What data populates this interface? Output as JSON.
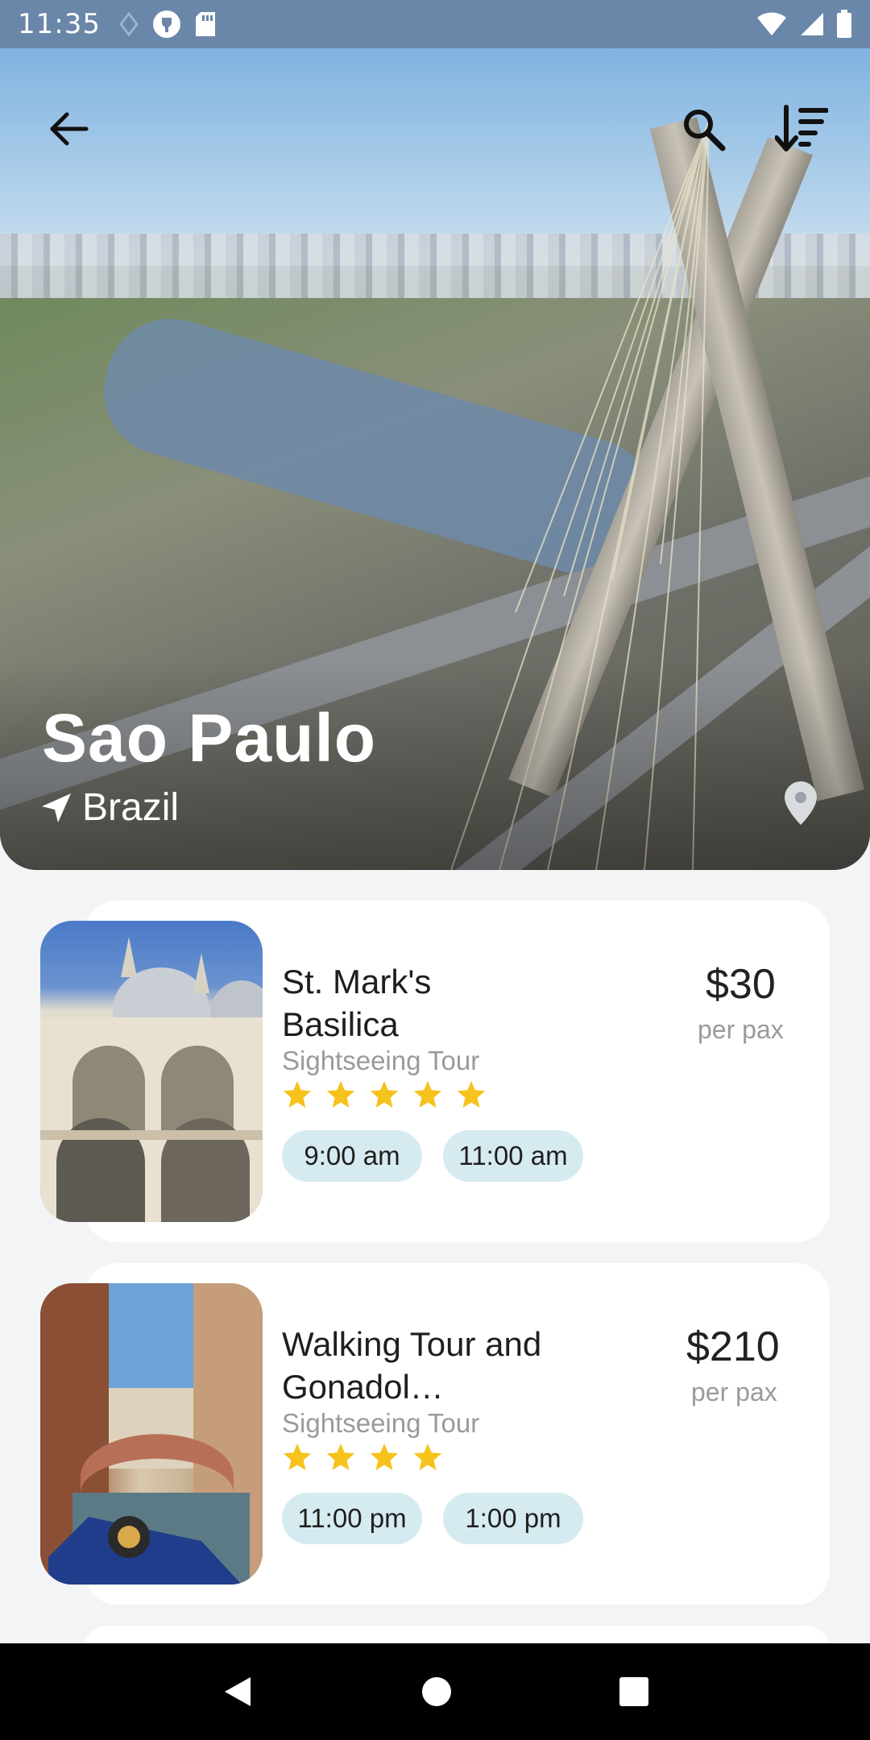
{
  "status_bar": {
    "time": "11:35"
  },
  "hero": {
    "city": "Sao Paulo",
    "country": "Brazil"
  },
  "tours": [
    {
      "title": "St. Mark's Basilica",
      "category": "Sightseeing Tour",
      "rating": 5,
      "price": "$30",
      "price_unit": "per pax",
      "times": [
        "9:00 am",
        "11:00 am"
      ]
    },
    {
      "title": "Walking Tour and Gonadol…",
      "category": "Sightseeing Tour",
      "rating": 4,
      "price": "$210",
      "price_unit": "per pax",
      "times": [
        "11:00 pm",
        "1:00 pm"
      ]
    }
  ],
  "colors": {
    "chip": "#d6ebf0",
    "star": "#f6c21c",
    "card": "#ffffff",
    "page": "#f3f4f6"
  }
}
